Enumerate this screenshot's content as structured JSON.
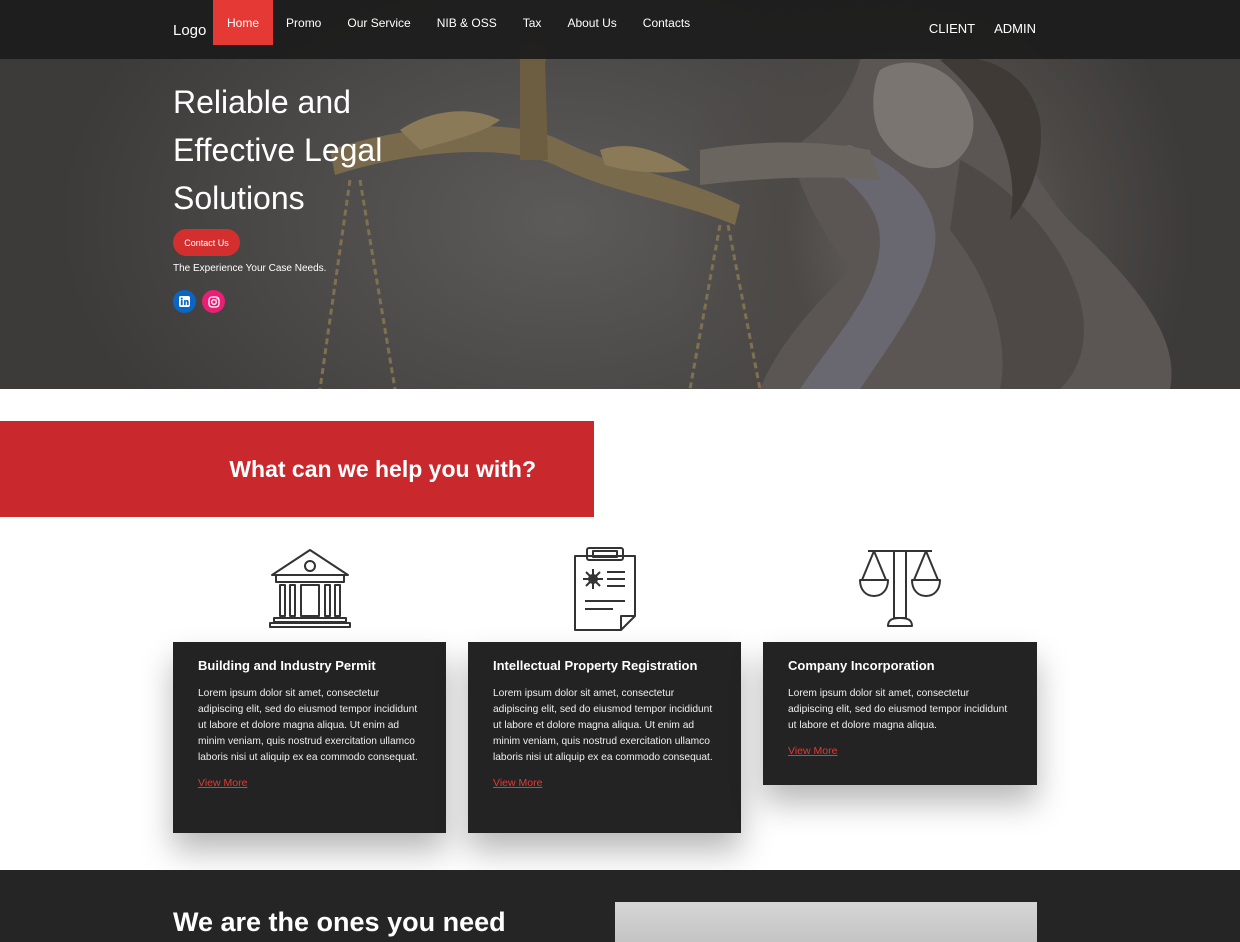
{
  "nav": {
    "logo": "Logo",
    "items": [
      "Home",
      "Promo",
      "Our Service",
      "NIB & OSS",
      "Tax",
      "About Us",
      "Contacts"
    ],
    "active": "Home",
    "right": [
      "CLIENT",
      "ADMIN"
    ]
  },
  "hero": {
    "title": "Reliable and Effective Legal Solutions",
    "cta": "Contact Us",
    "tagline": "The Experience Your Case Needs.",
    "social": [
      "linkedin-icon",
      "instagram-icon"
    ]
  },
  "help": {
    "title": "What can we help you with?"
  },
  "services": [
    {
      "icon": "bank-building-icon",
      "title": "Building and Industry Permit",
      "body": "Lorem ipsum dolor sit amet, consectetur adipiscing elit, sed do eiusmod tempor incididunt ut labore et dolore magna aliqua. Ut enim ad minim veniam, quis nostrud exercitation ullamco laboris nisi ut aliquip ex ea commodo consequat.",
      "link": "View More"
    },
    {
      "icon": "clipboard-document-icon",
      "title": "Intellectual Property Registration",
      "body": "Lorem ipsum dolor sit amet, consectetur adipiscing elit, sed do eiusmod tempor incididunt ut labore et dolore magna aliqua. Ut enim ad minim veniam, quis nostrud exercitation ullamco laboris nisi ut aliquip ex ea commodo consequat.",
      "link": "View More"
    },
    {
      "icon": "scales-icon",
      "title": "Company Incorporation",
      "body": "Lorem ipsum dolor sit amet, consectetur adipiscing elit, sed do eiusmod tempor incididunt ut labore et dolore magna aliqua.",
      "link": "View More"
    }
  ],
  "bottom": {
    "title": "We are the ones you need"
  },
  "colors": {
    "accent": "#e53935",
    "banner": "#c9282d",
    "dark": "#232323"
  }
}
